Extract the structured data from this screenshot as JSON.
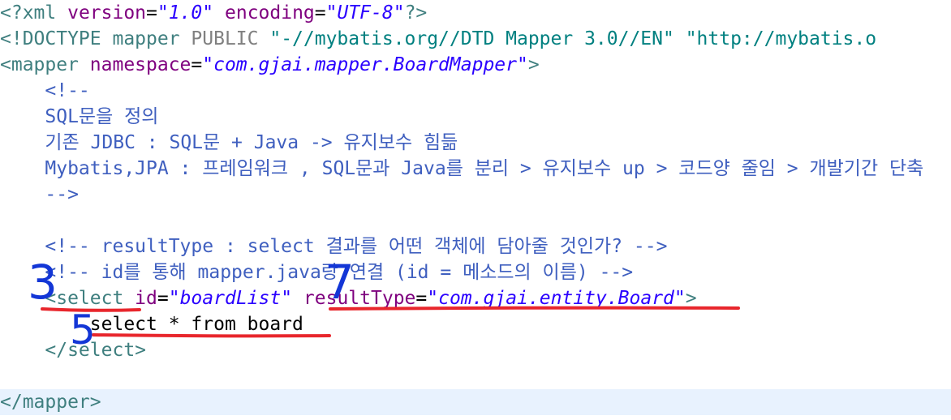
{
  "lines": [
    [
      {
        "c": "t-tag",
        "t": "<?xml "
      },
      {
        "c": "t-attr",
        "t": "version"
      },
      {
        "c": "t-txt",
        "t": "="
      },
      {
        "c": "t-val",
        "t": "\"1.0\""
      },
      {
        "c": "t-txt",
        "t": " "
      },
      {
        "c": "t-attr",
        "t": "encoding"
      },
      {
        "c": "t-txt",
        "t": "="
      },
      {
        "c": "t-val",
        "t": "\"UTF-8\""
      },
      {
        "c": "t-tag",
        "t": "?>"
      }
    ],
    [
      {
        "c": "t-tag",
        "t": "<!DOCTYPE mapper "
      },
      {
        "c": "t-gray",
        "t": "PUBLIC"
      },
      {
        "c": "t-dtd",
        "t": " \"-//mybatis.org//DTD Mapper 3.0//EN\" \"http://mybatis.o"
      }
    ],
    [
      {
        "c": "t-tag",
        "t": "<mapper "
      },
      {
        "c": "t-attr",
        "t": "namespace"
      },
      {
        "c": "t-txt",
        "t": "="
      },
      {
        "c": "t-val",
        "t": "\"com.gjai.mapper.BoardMapper\""
      },
      {
        "c": "t-tag",
        "t": ">"
      }
    ],
    [
      {
        "c": "t-cmt",
        "t": "    <!--"
      }
    ],
    [
      {
        "c": "t-cmt",
        "t": "    SQL문을 정의"
      }
    ],
    [
      {
        "c": "t-cmt",
        "t": "    기존 JDBC : SQL문 + Java -> 유지보수 힘듦"
      }
    ],
    [
      {
        "c": "t-cmt",
        "t": "    Mybatis,JPA : 프레임워크 , SQL문과 Java를 분리 > 유지보수 up > 코드양 줄임 > 개발기간 단축"
      }
    ],
    [
      {
        "c": "t-cmt",
        "t": "    -->"
      }
    ],
    [
      {
        "c": "t-txt",
        "t": ""
      }
    ],
    [
      {
        "c": "t-cmt",
        "t": "    <!-- resultType : select 결과를 어떤 객체에 담아줄 것인가? -->"
      }
    ],
    [
      {
        "c": "t-cmt",
        "t": "    <!-- id를 통해 mapper.java랑 연결 (id = 메소드의 이름) -->"
      }
    ],
    [
      {
        "c": "t-tag",
        "t": "    <select "
      },
      {
        "c": "t-attr",
        "t": "id"
      },
      {
        "c": "t-txt",
        "t": "="
      },
      {
        "c": "t-val",
        "t": "\"boardList\""
      },
      {
        "c": "t-txt",
        "t": " "
      },
      {
        "c": "t-attr",
        "t": "resultType"
      },
      {
        "c": "t-txt",
        "t": "="
      },
      {
        "c": "t-val",
        "t": "\"com.gjai.entity.Board\""
      },
      {
        "c": "t-tag",
        "t": ">"
      }
    ],
    [
      {
        "c": "t-txt",
        "t": "        select * from board"
      }
    ],
    [
      {
        "c": "t-tag",
        "t": "    </select>"
      }
    ],
    [
      {
        "c": "t-txt",
        "t": ""
      }
    ],
    [
      {
        "c": "t-tag",
        "t": "</mapper>"
      }
    ]
  ],
  "annotations": {
    "marks": [
      "3",
      "7",
      "5"
    ],
    "underline_color": "#e8262c",
    "number_color": "#1336d6"
  }
}
